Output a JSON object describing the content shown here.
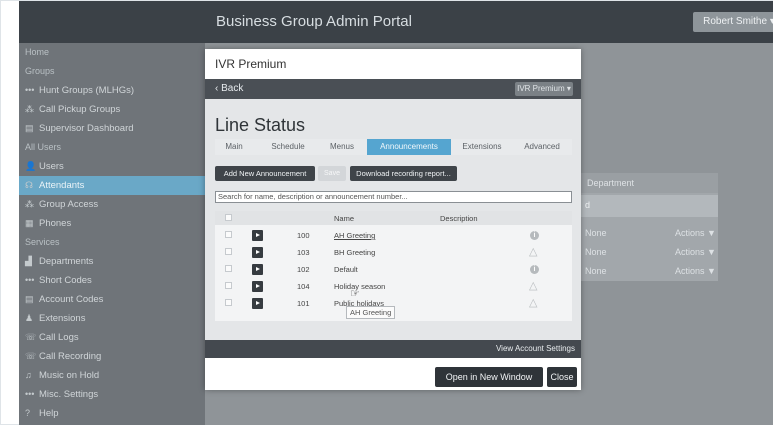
{
  "portal": {
    "title": "Business Group Admin Portal",
    "user_button": "Robert Smithe ▾"
  },
  "sidebar": {
    "items": [
      {
        "label": "Home",
        "icon": "",
        "type": "section"
      },
      {
        "label": "Groups",
        "icon": "",
        "type": "section"
      },
      {
        "label": "Hunt Groups (MLHGs)",
        "icon": "dots-icon",
        "glyph": "•••",
        "type": "item"
      },
      {
        "label": "Call Pickup Groups",
        "icon": "pickup-icon",
        "glyph": "⁂",
        "type": "item"
      },
      {
        "label": "Supervisor Dashboard",
        "icon": "dashboard-icon",
        "glyph": "▤",
        "type": "item"
      },
      {
        "label": "All Users",
        "icon": "",
        "type": "section"
      },
      {
        "label": "Users",
        "icon": "user-icon",
        "glyph": "👤",
        "type": "item"
      },
      {
        "label": "Attendants",
        "icon": "attendant-icon",
        "glyph": "☊",
        "type": "active"
      },
      {
        "label": "Group Access",
        "icon": "group-icon",
        "glyph": "⁂",
        "type": "item"
      },
      {
        "label": "Phones",
        "icon": "phone-icon",
        "glyph": "▦",
        "type": "item"
      },
      {
        "label": "Services",
        "icon": "",
        "type": "section"
      },
      {
        "label": "Departments",
        "icon": "building-icon",
        "glyph": "▟",
        "type": "item"
      },
      {
        "label": "Short Codes",
        "icon": "dots-icon",
        "glyph": "•••",
        "type": "item"
      },
      {
        "label": "Account Codes",
        "icon": "codes-icon",
        "glyph": "▤",
        "type": "item"
      },
      {
        "label": "Extensions",
        "icon": "extension-icon",
        "glyph": "♟",
        "type": "item"
      },
      {
        "label": "Call Logs",
        "icon": "phone-icon",
        "glyph": "☏",
        "type": "item"
      },
      {
        "label": "Call Recording",
        "icon": "phone-icon",
        "glyph": "☏",
        "type": "item"
      },
      {
        "label": "Music on Hold",
        "icon": "music-icon",
        "glyph": "♫",
        "type": "item"
      },
      {
        "label": "Misc. Settings",
        "icon": "dots-icon",
        "glyph": "•••",
        "type": "item"
      },
      {
        "label": "Help",
        "icon": "help-icon",
        "glyph": "?",
        "type": "item"
      }
    ]
  },
  "background_panel": {
    "header": "Department",
    "select_value": "d",
    "rows": [
      {
        "dept": "None",
        "actions": "Actions ▼"
      },
      {
        "dept": "None",
        "actions": "Actions ▼"
      },
      {
        "dept": "None",
        "actions": "Actions ▼"
      }
    ]
  },
  "modal": {
    "title": "IVR Premium",
    "back": "Back",
    "ivr_dropdown": "IVR Premium ▾",
    "heading": "Line Status",
    "tabs": [
      {
        "label": "Main"
      },
      {
        "label": "Schedule"
      },
      {
        "label": "Menus"
      },
      {
        "label": "Announcements",
        "active": true
      },
      {
        "label": "Extensions"
      },
      {
        "label": "Advanced"
      }
    ],
    "add_button": "Add New Announcement",
    "save_button": "Save",
    "download_button": "Download recording report...",
    "search_placeholder": "Search for name, description or announcement number...",
    "columns": {
      "name": "Name",
      "description": "Description"
    },
    "rows": [
      {
        "number": "100",
        "name": "AH Greeting",
        "status": "info"
      },
      {
        "number": "103",
        "name": "BH Greeting",
        "status": "warning"
      },
      {
        "number": "102",
        "name": "Default",
        "status": "info"
      },
      {
        "number": "104",
        "name": "Holiday season",
        "status": "warning"
      },
      {
        "number": "101",
        "name": "Public holidays",
        "status": "warning"
      }
    ],
    "tooltip": "AH Greeting",
    "view_account_settings": "View Account Settings",
    "open_new_window": "Open in New Window",
    "close": "Close"
  },
  "colors": {
    "accent": "#55a5d0",
    "dark": "#3f4449",
    "sidebar": "#6f7479"
  }
}
